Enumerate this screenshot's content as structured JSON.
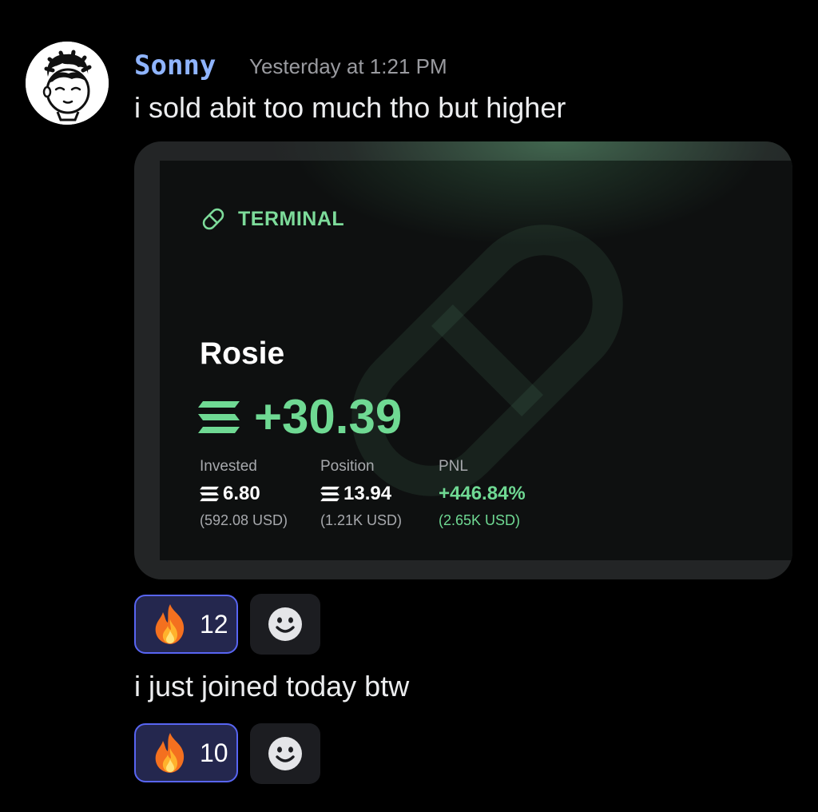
{
  "message": {
    "author": "Sonny",
    "timestamp": "Yesterday at 1:21 PM",
    "avatar_icon": "cartoon-boy-avatar-icon",
    "username_color": "#8fb4ff"
  },
  "messages": [
    {
      "text": "i sold abit too much tho but higher",
      "reaction": {
        "emoji": "fire-icon",
        "count": "12"
      }
    },
    {
      "text": "i just joined today btw",
      "reaction": {
        "emoji": "fire-icon",
        "count": "10"
      }
    }
  ],
  "embed": {
    "brand": "TERMINAL",
    "brand_icon": "pill-icon",
    "token": "Rosie",
    "currency_icon": "solana-icon",
    "pnl": "+30.39",
    "stats": [
      {
        "label": "Invested",
        "value": "6.80",
        "sub": "(592.08 USD)",
        "has_currency_icon": true
      },
      {
        "label": "Position",
        "value": "13.94",
        "sub": "(1.21K USD)",
        "has_currency_icon": true
      },
      {
        "label": "PNL",
        "value": "+446.84%",
        "sub": "(2.65K USD)",
        "has_currency_icon": false
      }
    ],
    "accent_color": "#6fd993"
  },
  "add_reaction_icon": "smiley-face-icon",
  "reaction_border_color": "#5865f2"
}
